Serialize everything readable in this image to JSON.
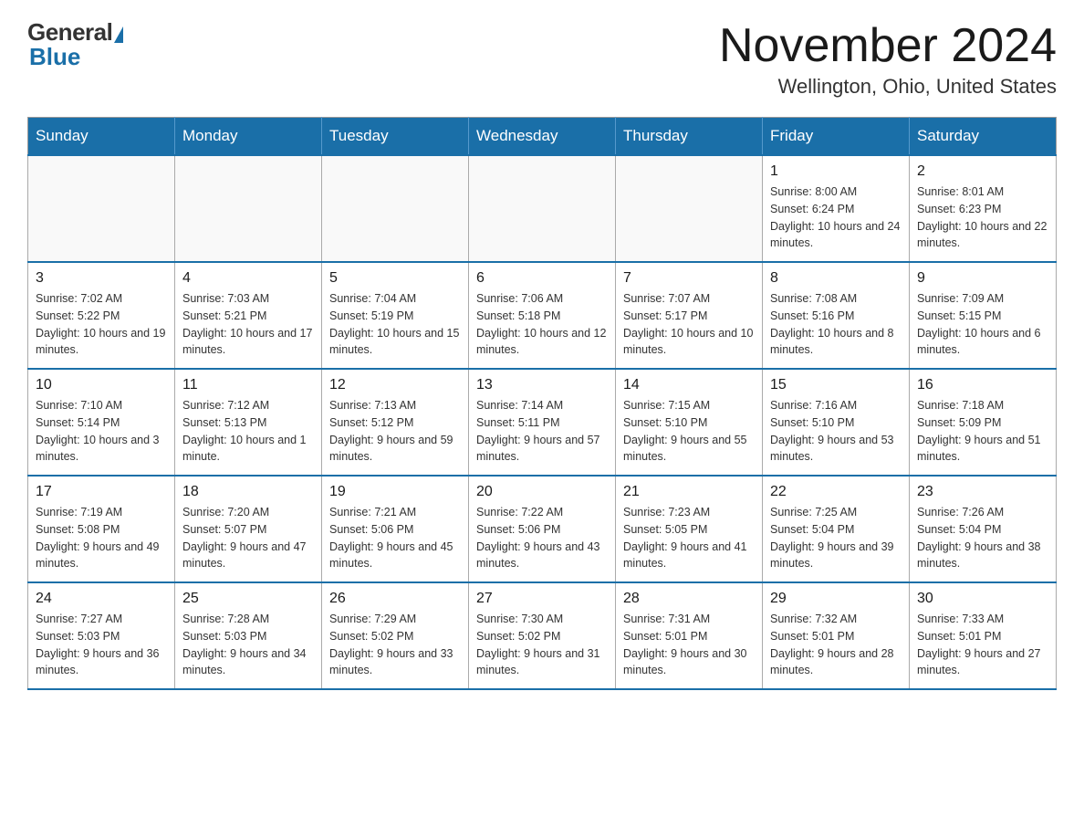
{
  "header": {
    "logo_general": "General",
    "logo_blue": "Blue",
    "title": "November 2024",
    "location": "Wellington, Ohio, United States"
  },
  "weekdays": [
    "Sunday",
    "Monday",
    "Tuesday",
    "Wednesday",
    "Thursday",
    "Friday",
    "Saturday"
  ],
  "weeks": [
    [
      {
        "day": "",
        "sunrise": "",
        "sunset": "",
        "daylight": ""
      },
      {
        "day": "",
        "sunrise": "",
        "sunset": "",
        "daylight": ""
      },
      {
        "day": "",
        "sunrise": "",
        "sunset": "",
        "daylight": ""
      },
      {
        "day": "",
        "sunrise": "",
        "sunset": "",
        "daylight": ""
      },
      {
        "day": "",
        "sunrise": "",
        "sunset": "",
        "daylight": ""
      },
      {
        "day": "1",
        "sunrise": "Sunrise: 8:00 AM",
        "sunset": "Sunset: 6:24 PM",
        "daylight": "Daylight: 10 hours and 24 minutes."
      },
      {
        "day": "2",
        "sunrise": "Sunrise: 8:01 AM",
        "sunset": "Sunset: 6:23 PM",
        "daylight": "Daylight: 10 hours and 22 minutes."
      }
    ],
    [
      {
        "day": "3",
        "sunrise": "Sunrise: 7:02 AM",
        "sunset": "Sunset: 5:22 PM",
        "daylight": "Daylight: 10 hours and 19 minutes."
      },
      {
        "day": "4",
        "sunrise": "Sunrise: 7:03 AM",
        "sunset": "Sunset: 5:21 PM",
        "daylight": "Daylight: 10 hours and 17 minutes."
      },
      {
        "day": "5",
        "sunrise": "Sunrise: 7:04 AM",
        "sunset": "Sunset: 5:19 PM",
        "daylight": "Daylight: 10 hours and 15 minutes."
      },
      {
        "day": "6",
        "sunrise": "Sunrise: 7:06 AM",
        "sunset": "Sunset: 5:18 PM",
        "daylight": "Daylight: 10 hours and 12 minutes."
      },
      {
        "day": "7",
        "sunrise": "Sunrise: 7:07 AM",
        "sunset": "Sunset: 5:17 PM",
        "daylight": "Daylight: 10 hours and 10 minutes."
      },
      {
        "day": "8",
        "sunrise": "Sunrise: 7:08 AM",
        "sunset": "Sunset: 5:16 PM",
        "daylight": "Daylight: 10 hours and 8 minutes."
      },
      {
        "day": "9",
        "sunrise": "Sunrise: 7:09 AM",
        "sunset": "Sunset: 5:15 PM",
        "daylight": "Daylight: 10 hours and 6 minutes."
      }
    ],
    [
      {
        "day": "10",
        "sunrise": "Sunrise: 7:10 AM",
        "sunset": "Sunset: 5:14 PM",
        "daylight": "Daylight: 10 hours and 3 minutes."
      },
      {
        "day": "11",
        "sunrise": "Sunrise: 7:12 AM",
        "sunset": "Sunset: 5:13 PM",
        "daylight": "Daylight: 10 hours and 1 minute."
      },
      {
        "day": "12",
        "sunrise": "Sunrise: 7:13 AM",
        "sunset": "Sunset: 5:12 PM",
        "daylight": "Daylight: 9 hours and 59 minutes."
      },
      {
        "day": "13",
        "sunrise": "Sunrise: 7:14 AM",
        "sunset": "Sunset: 5:11 PM",
        "daylight": "Daylight: 9 hours and 57 minutes."
      },
      {
        "day": "14",
        "sunrise": "Sunrise: 7:15 AM",
        "sunset": "Sunset: 5:10 PM",
        "daylight": "Daylight: 9 hours and 55 minutes."
      },
      {
        "day": "15",
        "sunrise": "Sunrise: 7:16 AM",
        "sunset": "Sunset: 5:10 PM",
        "daylight": "Daylight: 9 hours and 53 minutes."
      },
      {
        "day": "16",
        "sunrise": "Sunrise: 7:18 AM",
        "sunset": "Sunset: 5:09 PM",
        "daylight": "Daylight: 9 hours and 51 minutes."
      }
    ],
    [
      {
        "day": "17",
        "sunrise": "Sunrise: 7:19 AM",
        "sunset": "Sunset: 5:08 PM",
        "daylight": "Daylight: 9 hours and 49 minutes."
      },
      {
        "day": "18",
        "sunrise": "Sunrise: 7:20 AM",
        "sunset": "Sunset: 5:07 PM",
        "daylight": "Daylight: 9 hours and 47 minutes."
      },
      {
        "day": "19",
        "sunrise": "Sunrise: 7:21 AM",
        "sunset": "Sunset: 5:06 PM",
        "daylight": "Daylight: 9 hours and 45 minutes."
      },
      {
        "day": "20",
        "sunrise": "Sunrise: 7:22 AM",
        "sunset": "Sunset: 5:06 PM",
        "daylight": "Daylight: 9 hours and 43 minutes."
      },
      {
        "day": "21",
        "sunrise": "Sunrise: 7:23 AM",
        "sunset": "Sunset: 5:05 PM",
        "daylight": "Daylight: 9 hours and 41 minutes."
      },
      {
        "day": "22",
        "sunrise": "Sunrise: 7:25 AM",
        "sunset": "Sunset: 5:04 PM",
        "daylight": "Daylight: 9 hours and 39 minutes."
      },
      {
        "day": "23",
        "sunrise": "Sunrise: 7:26 AM",
        "sunset": "Sunset: 5:04 PM",
        "daylight": "Daylight: 9 hours and 38 minutes."
      }
    ],
    [
      {
        "day": "24",
        "sunrise": "Sunrise: 7:27 AM",
        "sunset": "Sunset: 5:03 PM",
        "daylight": "Daylight: 9 hours and 36 minutes."
      },
      {
        "day": "25",
        "sunrise": "Sunrise: 7:28 AM",
        "sunset": "Sunset: 5:03 PM",
        "daylight": "Daylight: 9 hours and 34 minutes."
      },
      {
        "day": "26",
        "sunrise": "Sunrise: 7:29 AM",
        "sunset": "Sunset: 5:02 PM",
        "daylight": "Daylight: 9 hours and 33 minutes."
      },
      {
        "day": "27",
        "sunrise": "Sunrise: 7:30 AM",
        "sunset": "Sunset: 5:02 PM",
        "daylight": "Daylight: 9 hours and 31 minutes."
      },
      {
        "day": "28",
        "sunrise": "Sunrise: 7:31 AM",
        "sunset": "Sunset: 5:01 PM",
        "daylight": "Daylight: 9 hours and 30 minutes."
      },
      {
        "day": "29",
        "sunrise": "Sunrise: 7:32 AM",
        "sunset": "Sunset: 5:01 PM",
        "daylight": "Daylight: 9 hours and 28 minutes."
      },
      {
        "day": "30",
        "sunrise": "Sunrise: 7:33 AM",
        "sunset": "Sunset: 5:01 PM",
        "daylight": "Daylight: 9 hours and 27 minutes."
      }
    ]
  ]
}
